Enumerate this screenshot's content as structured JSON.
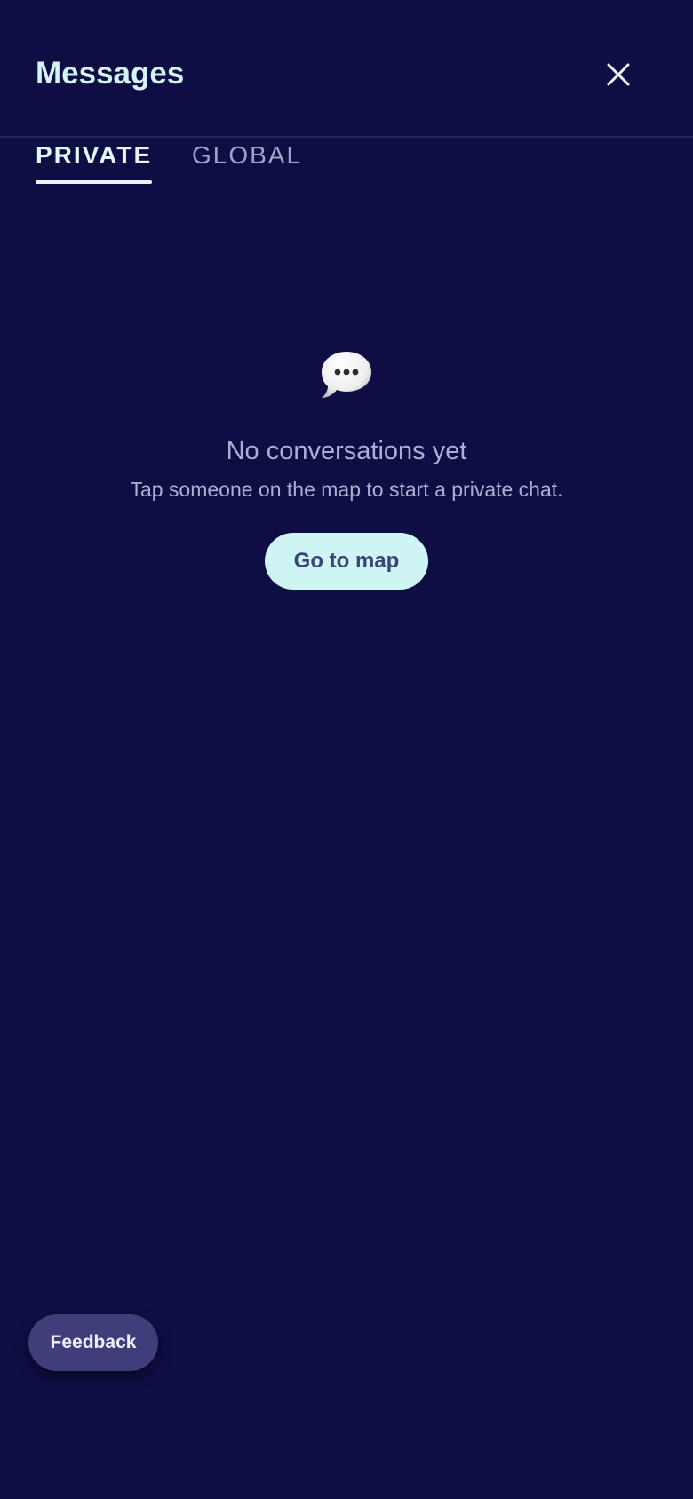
{
  "header": {
    "title": "Messages",
    "close_icon": "close-icon"
  },
  "tabs": [
    {
      "label": "PRIVATE",
      "active": true
    },
    {
      "label": "GLOBAL",
      "active": false
    }
  ],
  "empty_state": {
    "icon": "speech-bubble-icon",
    "title": "No conversations yet",
    "subtitle": "Tap someone on the map to start a private chat.",
    "button_label": "Go to map"
  },
  "feedback": {
    "label": "Feedback"
  },
  "colors": {
    "background": "#0e0e45",
    "title": "#d4f4f4",
    "accent_button": "#cef4f3",
    "muted_text": "#a9b0d3",
    "feedback_button": "#3f3d7a"
  }
}
